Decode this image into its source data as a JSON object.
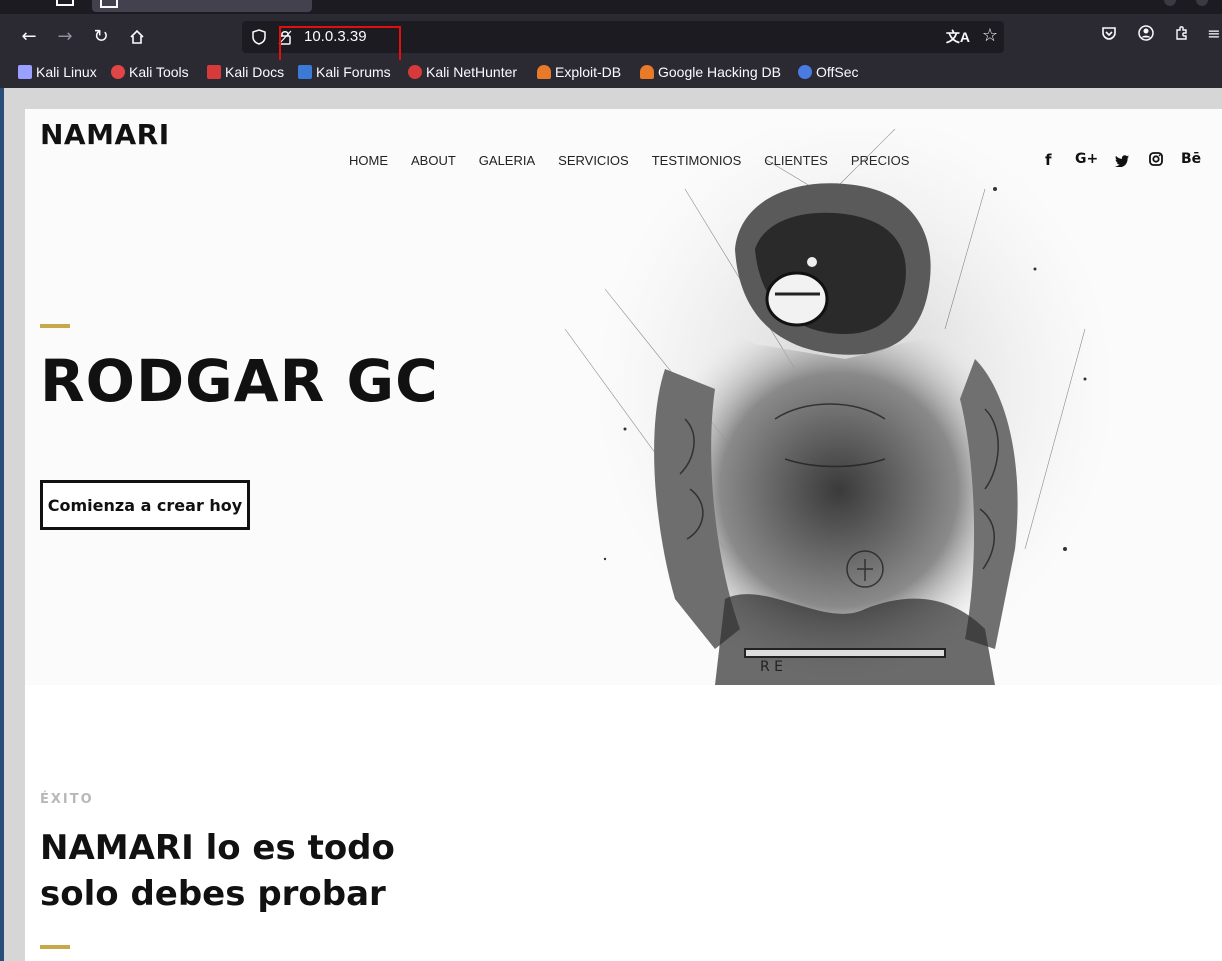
{
  "browser": {
    "url": "10.0.3.39",
    "bookmarks": [
      {
        "label": "Kali Linux",
        "icon": "kali-dragon-icon",
        "color": "#9aa0ff"
      },
      {
        "label": "Kali Tools",
        "icon": "kali-tools-icon",
        "color": "#e04646"
      },
      {
        "label": "Kali Docs",
        "icon": "kali-docs-icon",
        "color": "#d63a3a"
      },
      {
        "label": "Kali Forums",
        "icon": "kali-forums-icon",
        "color": "#3b7bd6"
      },
      {
        "label": "Kali NetHunter",
        "icon": "kali-nethunter-icon",
        "color": "#d63a3a"
      },
      {
        "label": "Exploit-DB",
        "icon": "exploit-db-icon",
        "color": "#e87a2a"
      },
      {
        "label": "Google Hacking DB",
        "icon": "ghdb-icon",
        "color": "#e87a2a"
      },
      {
        "label": "OffSec",
        "icon": "offsec-icon",
        "color": "#4a7be0"
      }
    ]
  },
  "site": {
    "logo": "NAMARI",
    "nav": [
      "HOME",
      "ABOUT",
      "GALERIA",
      "SERVICIOS",
      "TESTIMONIOS",
      "CLIENTES",
      "PRECIOS"
    ],
    "social": [
      "f",
      "G+",
      "twitter",
      "instagram",
      "Bē"
    ],
    "accent_color": "#c8a94a"
  },
  "hero": {
    "title": "RODGAR GC",
    "cta_label": "Comienza a crear hoy"
  },
  "section": {
    "eyebrow": "ÉXITO",
    "title_line1": "NAMARI lo es todo",
    "title_line2": "solo debes probar"
  }
}
